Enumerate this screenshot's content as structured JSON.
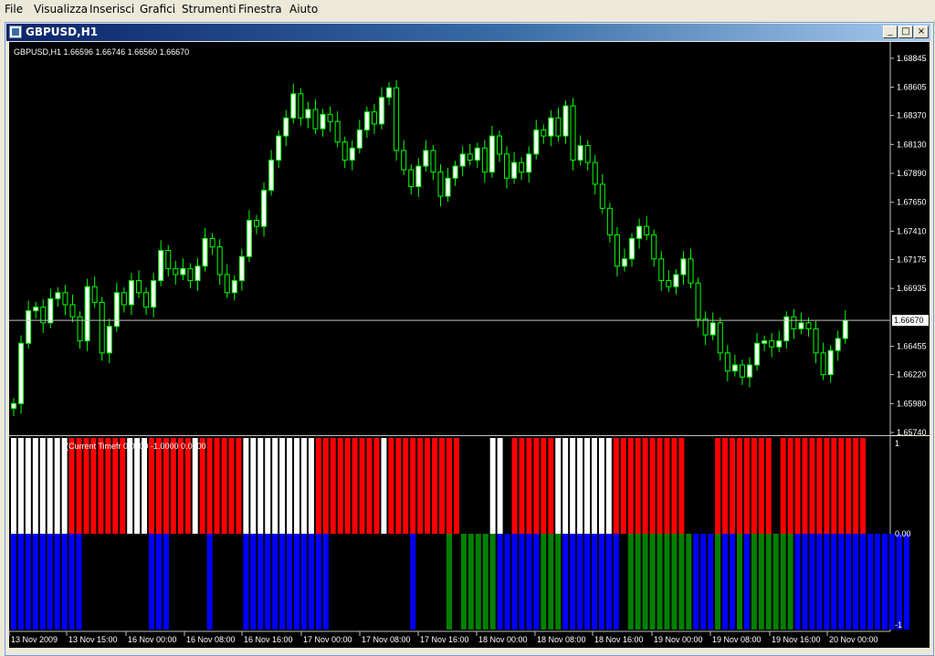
{
  "menu": [
    "File",
    "Visualizza",
    "Inserisci",
    "Grafici",
    "Strumenti",
    "Finestra",
    "Aiuto"
  ],
  "window": {
    "title": "GBPUSD,H1",
    "minimize": "_",
    "maximize": "□",
    "close": "×"
  },
  "chart": {
    "symbol_header": "GBPUSD,H1  1.66596 1.66746 1.66560 1.66670",
    "current_price": "1.66670",
    "price_axis": [
      "1.68845",
      "1.68605",
      "1.68370",
      "1.68130",
      "1.67890",
      "1.67650",
      "1.67410",
      "1.67175",
      "1.66935",
      "1.66455",
      "1.66220",
      "1.65980",
      "1.65740"
    ],
    "indicator_label": "(Current Timefr    0.0000 -1.0000 0.0000",
    "indicator_axis": [
      "1",
      "0.00",
      "-1"
    ],
    "time_axis": [
      "13 Nov 2009",
      "13 Nov 15:00",
      "16 Nov 00:00",
      "16 Nov 08:00",
      "16 Nov 16:00",
      "17 Nov 00:00",
      "17 Nov 08:00",
      "17 Nov 16:00",
      "18 Nov 00:00",
      "18 Nov 08:00",
      "18 Nov 16:00",
      "19 Nov 00:00",
      "19 Nov 08:00",
      "19 Nov 16:00",
      "20 Nov 00:00"
    ],
    "colors": {
      "bg": "#000000",
      "candle": "#00ff00",
      "bull_body": "#ffffff",
      "bear_body": "#000000",
      "red": "#ff0000",
      "white": "#ffffff",
      "blue": "#0000ff",
      "green": "#008000",
      "axis_text": "#ffffff",
      "grid": "#c0c0c0"
    }
  },
  "chart_data": [
    {
      "type": "candlestick",
      "title": "GBPUSD,H1",
      "ylim": [
        1.6574,
        1.6895
      ],
      "close": [
        1.6598,
        1.6648,
        1.6675,
        1.6678,
        1.6665,
        1.6685,
        1.669,
        1.668,
        1.667,
        1.665,
        1.6695,
        1.6682,
        1.664,
        1.6662,
        1.669,
        1.668,
        1.67,
        1.669,
        1.6678,
        1.67,
        1.6725,
        1.671,
        1.6705,
        1.671,
        1.67,
        1.6712,
        1.6735,
        1.6728,
        1.6705,
        1.669,
        1.67,
        1.672,
        1.675,
        1.6745,
        1.6775,
        1.68,
        1.682,
        1.6835,
        1.6855,
        1.6835,
        1.6842,
        1.6826,
        1.6838,
        1.6832,
        1.6815,
        1.68,
        1.681,
        1.6825,
        1.684,
        1.683,
        1.6852,
        1.686,
        1.6808,
        1.6792,
        1.6778,
        1.6795,
        1.6808,
        1.679,
        1.677,
        1.6785,
        1.6795,
        1.6805,
        1.68,
        1.681,
        1.679,
        1.682,
        1.6805,
        1.6785,
        1.6798,
        1.679,
        1.6805,
        1.6825,
        1.682,
        1.6835,
        1.682,
        1.6845,
        1.68,
        1.6812,
        1.6798,
        1.678,
        1.676,
        1.6738,
        1.6712,
        1.6718,
        1.6735,
        1.6745,
        1.6738,
        1.6718,
        1.67,
        1.6695,
        1.6705,
        1.6718,
        1.6698,
        1.6668,
        1.6655,
        1.6665,
        1.664,
        1.6625,
        1.663,
        1.662,
        1.663,
        1.6648,
        1.665,
        1.6645,
        1.665,
        1.667,
        1.666,
        1.6665,
        1.666,
        1.664,
        1.6622,
        1.6642,
        1.6652,
        1.6667
      ],
      "x_axis": "time"
    },
    {
      "type": "bar",
      "title": "",
      "ylim": [
        -1,
        1
      ],
      "upper": [
        "W",
        "W",
        "W",
        "W",
        "W",
        "W",
        "W",
        "W",
        "R",
        "R",
        "R",
        "R",
        "R",
        "R",
        "R",
        "R",
        "W",
        "W",
        "W",
        "R",
        "R",
        "R",
        "R",
        "R",
        "R",
        "W",
        "R",
        "R",
        "R",
        "R",
        "R",
        "R",
        "W",
        "W",
        "W",
        "W",
        "W",
        "W",
        "W",
        "W",
        "W",
        "W",
        "R",
        "R",
        "R",
        "R",
        "R",
        "R",
        "R",
        "R",
        "R",
        "W",
        "R",
        "R",
        "R",
        "R",
        "R",
        "R",
        "R",
        "R",
        "R",
        "R",
        "N",
        "N",
        "N",
        "N",
        "W",
        "W",
        "N",
        "R",
        "R",
        "R",
        "R",
        "R",
        "R",
        "W",
        "W",
        "W",
        "W",
        "W",
        "W",
        "W",
        "W",
        "R",
        "R",
        "R",
        "R",
        "R",
        "R",
        "R",
        "R",
        "R",
        "R",
        "N",
        "N",
        "N",
        "N",
        "R",
        "R",
        "R",
        "R",
        "R",
        "R",
        "R",
        "R",
        "N",
        "R",
        "R",
        "R",
        "R",
        "R",
        "R",
        "R",
        "R",
        "R",
        "R",
        "R",
        "R",
        "N"
      ],
      "lower": [
        "B",
        "B",
        "B",
        "B",
        "B",
        "B",
        "B",
        "B",
        "B",
        "B",
        "N",
        "N",
        "N",
        "N",
        "N",
        "N",
        "N",
        "N",
        "N",
        "B",
        "B",
        "B",
        "N",
        "N",
        "N",
        "N",
        "N",
        "B",
        "N",
        "N",
        "N",
        "N",
        "B",
        "B",
        "B",
        "B",
        "B",
        "B",
        "B",
        "B",
        "B",
        "B",
        "B",
        "B",
        "N",
        "N",
        "N",
        "N",
        "N",
        "N",
        "N",
        "N",
        "N",
        "N",
        "N",
        "B",
        "N",
        "N",
        "N",
        "N",
        "G",
        "N",
        "G",
        "G",
        "G",
        "G",
        "G",
        "B",
        "B",
        "B",
        "B",
        "B",
        "B",
        "G",
        "G",
        "G",
        "B",
        "B",
        "B",
        "B",
        "B",
        "B",
        "B",
        "B",
        "N",
        "G",
        "G",
        "G",
        "G",
        "G",
        "G",
        "G",
        "G",
        "G",
        "B",
        "B",
        "B",
        "G",
        "B",
        "B",
        "G",
        "B",
        "G",
        "G",
        "G",
        "G",
        "G",
        "G",
        "B",
        "B",
        "B",
        "B",
        "B",
        "B",
        "B",
        "B",
        "B",
        "B",
        "B",
        "B",
        "B",
        "B",
        "B",
        "B"
      ],
      "legend": "R=red W=white B=blue G=green N=none"
    }
  ]
}
